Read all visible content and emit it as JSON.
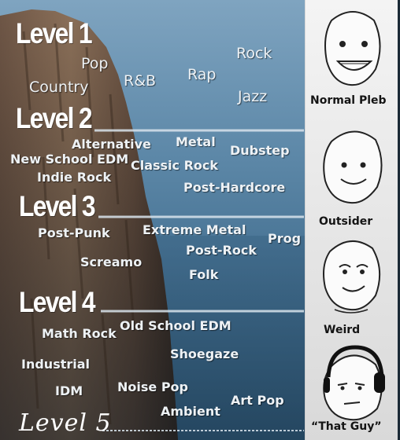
{
  "levels": {
    "level1": "Level 1",
    "level2": "Level 2",
    "level3": "Level 3",
    "level4": "Level 4",
    "level5": "Level 5"
  },
  "genres": {
    "l1": [
      "Pop",
      "Country",
      "R&B",
      "Rap",
      "Rock",
      "Jazz"
    ],
    "l2": [
      "Alternative",
      "Metal",
      "Dubstep",
      "New School EDM",
      "Classic Rock",
      "Indie Rock",
      "Post-Hardcore"
    ],
    "l3": [
      "Post-Punk",
      "Extreme Metal",
      "Prog",
      "Post-Rock",
      "Screamo",
      "Folk"
    ],
    "l4": [
      "Math Rock",
      "Old School EDM",
      "Shoegaze",
      "Industrial",
      "Noise Pop",
      "IDM",
      "Art Pop",
      "Ambient"
    ]
  },
  "characters": [
    "Normal Pleb",
    "Outsider",
    "Weird",
    "“That Guy”"
  ],
  "colors": {
    "sky": "#3a6a8c",
    "cliff": "#8a6e55",
    "panel": "#f1f1f1",
    "divider": "#d9e4ec",
    "text": "#ffffff"
  }
}
